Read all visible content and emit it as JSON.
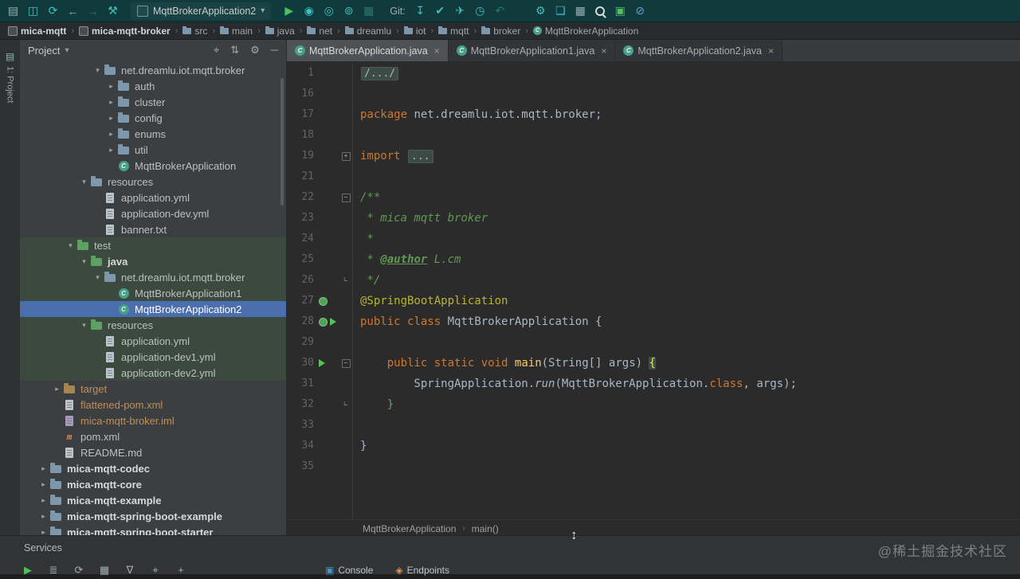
{
  "ui": {
    "chevron": "▾",
    "close": "×",
    "tree_open": "▾",
    "tree_closed": "▸",
    "class_letter": "C",
    "maven_letter": "m",
    "fold_plus": "+",
    "fold_minus": "−",
    "fold_end": "∟"
  },
  "toolbar": {
    "run_config": "MqttBrokerApplication2",
    "git_label": "Git:",
    "groups": {
      "left": [
        {
          "name": "window-menu-icon",
          "glyph": "▤",
          "color": "gray"
        },
        {
          "name": "save-all-icon",
          "glyph": "◫",
          "color": "teal"
        },
        {
          "name": "sync-icon",
          "glyph": "⟳",
          "color": "teal"
        },
        {
          "name": "back-icon",
          "glyph": "←",
          "color": "gray"
        },
        {
          "name": "forward-icon",
          "glyph": "→",
          "color": "dim"
        },
        {
          "name": "build-icon",
          "glyph": "⚒",
          "color": "teal"
        }
      ],
      "run": [
        {
          "name": "run-icon",
          "glyph": "▶",
          "color": "green"
        },
        {
          "name": "debug-icon",
          "glyph": "◉",
          "color": "teal"
        },
        {
          "name": "coverage-icon",
          "glyph": "◎",
          "color": "teal"
        },
        {
          "name": "profiler-icon",
          "glyph": "⊚",
          "color": "teal"
        },
        {
          "name": "run-dashboard-icon",
          "glyph": "▦",
          "color": "dim"
        }
      ],
      "git": [
        {
          "name": "git-update-icon",
          "glyph": "↧",
          "color": "teal"
        },
        {
          "name": "git-commit-icon",
          "glyph": "✔",
          "color": "teal"
        },
        {
          "name": "git-push-icon",
          "glyph": "✈",
          "color": "teal"
        },
        {
          "name": "history-icon",
          "glyph": "◷",
          "color": "teal"
        },
        {
          "name": "rollback-icon",
          "glyph": "↶",
          "color": "dim"
        }
      ],
      "right": [
        {
          "name": "tools-icon",
          "glyph": "⚙",
          "color": "teal"
        },
        {
          "name": "open-folder-icon",
          "glyph": "❏",
          "color": "teal"
        },
        {
          "name": "layout-icon",
          "glyph": "▦",
          "color": "gray"
        },
        {
          "name": "search-everywhere-icon",
          "glyph": "search",
          "color": "light"
        },
        {
          "name": "plugin-icon",
          "glyph": "▣",
          "color": "green"
        },
        {
          "name": "do-not-disturb-icon",
          "glyph": "⊘",
          "color": "blue"
        }
      ]
    }
  },
  "breadcrumbs": {
    "separator": "›",
    "items": [
      {
        "label": "mica-mqtt",
        "icon": "module",
        "bold": true
      },
      {
        "label": "mica-mqtt-broker",
        "icon": "module",
        "bold": true
      },
      {
        "label": "src",
        "icon": "folder"
      },
      {
        "label": "main",
        "icon": "folder"
      },
      {
        "label": "java",
        "icon": "folder"
      },
      {
        "label": "net",
        "icon": "folder"
      },
      {
        "label": "dreamlu",
        "icon": "folder"
      },
      {
        "label": "iot",
        "icon": "folder"
      },
      {
        "label": "mqtt",
        "icon": "folder"
      },
      {
        "label": "broker",
        "icon": "folder"
      },
      {
        "label": "MqttBrokerApplication",
        "icon": "class"
      }
    ]
  },
  "stripe": {
    "label": "1: Project",
    "icon": "▤"
  },
  "project": {
    "title": "Project",
    "header_icons": [
      {
        "name": "locate-icon",
        "glyph": "⌖"
      },
      {
        "name": "expand-collapse-icon",
        "glyph": "⇅"
      },
      {
        "name": "settings-icon",
        "glyph": "⚙"
      },
      {
        "name": "hide-panel-icon",
        "glyph": "─"
      }
    ],
    "tree": [
      {
        "l": "net.dreamlu.iot.mqtt.broker",
        "d": 5,
        "a": "o",
        "i": "pkg"
      },
      {
        "l": "auth",
        "d": 6,
        "a": "c",
        "i": "pkg"
      },
      {
        "l": "cluster",
        "d": 6,
        "a": "c",
        "i": "pkg"
      },
      {
        "l": "config",
        "d": 6,
        "a": "c",
        "i": "pkg"
      },
      {
        "l": "enums",
        "d": 6,
        "a": "c",
        "i": "pkg"
      },
      {
        "l": "util",
        "d": 6,
        "a": "c",
        "i": "pkg"
      },
      {
        "l": "MqttBrokerApplication",
        "d": 6,
        "a": null,
        "i": "class"
      },
      {
        "l": "resources",
        "d": 4,
        "a": "o",
        "i": "folder"
      },
      {
        "l": "application.yml",
        "d": 5,
        "a": null,
        "i": "yml"
      },
      {
        "l": "application-dev.yml",
        "d": 5,
        "a": null,
        "i": "yml"
      },
      {
        "l": "banner.txt",
        "d": 5,
        "a": null,
        "i": "txt"
      },
      {
        "l": "test",
        "d": 3,
        "a": "o",
        "i": "folder-test",
        "cls": "testbg"
      },
      {
        "l": "java",
        "d": 4,
        "a": "o",
        "i": "folder-test",
        "cls": "testbg b"
      },
      {
        "l": "net.dreamlu.iot.mqtt.broker",
        "d": 5,
        "a": "o",
        "i": "pkg",
        "cls": "testbg"
      },
      {
        "l": "MqttBrokerApplication1",
        "d": 6,
        "a": null,
        "i": "class",
        "cls": "testbg"
      },
      {
        "l": "MqttBrokerApplication2",
        "d": 6,
        "a": null,
        "i": "class",
        "cls": "sel"
      },
      {
        "l": "resources",
        "d": 4,
        "a": "o",
        "i": "folder-test",
        "cls": "testbg"
      },
      {
        "l": "application.yml",
        "d": 5,
        "a": null,
        "i": "yml",
        "cls": "testbg"
      },
      {
        "l": "application-dev1.yml",
        "d": 5,
        "a": null,
        "i": "yml",
        "cls": "testbg"
      },
      {
        "l": "application-dev2.yml",
        "d": 5,
        "a": null,
        "i": "yml",
        "cls": "testbg"
      },
      {
        "l": "target",
        "d": 2,
        "a": "c",
        "i": "folder-exc",
        "cls": "exc"
      },
      {
        "l": "flattened-pom.xml",
        "d": 2,
        "a": null,
        "i": "xml",
        "cls": "exc"
      },
      {
        "l": "mica-mqtt-broker.iml",
        "d": 2,
        "a": null,
        "i": "iml",
        "cls": "exc"
      },
      {
        "l": "pom.xml",
        "d": 2,
        "a": null,
        "i": "maven"
      },
      {
        "l": "README.md",
        "d": 2,
        "a": null,
        "i": "md"
      },
      {
        "l": "mica-mqtt-codec",
        "d": 1,
        "a": "c",
        "i": "folder",
        "cls": "b"
      },
      {
        "l": "mica-mqtt-core",
        "d": 1,
        "a": "c",
        "i": "folder",
        "cls": "b"
      },
      {
        "l": "mica-mqtt-example",
        "d": 1,
        "a": "c",
        "i": "folder",
        "cls": "b"
      },
      {
        "l": "mica-mqtt-spring-boot-example",
        "d": 1,
        "a": "c",
        "i": "folder",
        "cls": "b"
      },
      {
        "l": "mica-mqtt-spring-boot-starter",
        "d": 1,
        "a": "c",
        "i": "folder",
        "cls": "b"
      }
    ]
  },
  "tabs": [
    {
      "label": "MqttBrokerApplication.java",
      "active": true
    },
    {
      "label": "MqttBrokerApplication1.java",
      "active": false
    },
    {
      "label": "MqttBrokerApplication2.java",
      "active": false
    }
  ],
  "editor": {
    "lines": [
      {
        "n": "1",
        "t": [
          {
            "t": "/.../",
            "c": "fold"
          }
        ]
      },
      {
        "n": "16",
        "t": []
      },
      {
        "n": "17",
        "t": [
          {
            "t": "package",
            "c": "k"
          },
          {
            "t": " net.dreamlu.iot.mqtt.broker;",
            "c": "d"
          }
        ]
      },
      {
        "n": "18",
        "t": []
      },
      {
        "n": "19",
        "t": [
          {
            "t": "import",
            "c": "k"
          },
          {
            "t": " ",
            "c": "d"
          },
          {
            "t": "...",
            "c": "fold"
          }
        ],
        "f": "p"
      },
      {
        "n": "21",
        "t": []
      },
      {
        "n": "22",
        "t": [
          {
            "t": "/**",
            "c": "doc"
          }
        ],
        "f": "m"
      },
      {
        "n": "23",
        "t": [
          {
            "t": " * mica mqtt broker",
            "c": "doc"
          }
        ]
      },
      {
        "n": "24",
        "t": [
          {
            "t": " *",
            "c": "doc"
          }
        ]
      },
      {
        "n": "25",
        "t": [
          {
            "t": " * ",
            "c": "doc"
          },
          {
            "t": "@author",
            "c": "tag"
          },
          {
            "t": " L.cm",
            "c": "doc"
          }
        ]
      },
      {
        "n": "26",
        "t": [
          {
            "t": " */",
            "c": "doc"
          }
        ],
        "f": "e"
      },
      {
        "n": "27",
        "t": [
          {
            "t": "@SpringBootApplication",
            "c": "ann"
          }
        ],
        "g": [
          "spring"
        ]
      },
      {
        "n": "28",
        "t": [
          {
            "t": "public",
            "c": "k"
          },
          {
            "t": " ",
            "c": "d"
          },
          {
            "t": "class",
            "c": "k"
          },
          {
            "t": " MqttBrokerApplication {",
            "c": "d"
          }
        ],
        "g": [
          "spring",
          "run"
        ]
      },
      {
        "n": "29",
        "t": []
      },
      {
        "n": "30",
        "t": [
          {
            "t": "    ",
            "c": "d"
          },
          {
            "t": "public",
            "c": "k"
          },
          {
            "t": " ",
            "c": "d"
          },
          {
            "t": "static",
            "c": "k"
          },
          {
            "t": " ",
            "c": "d"
          },
          {
            "t": "void",
            "c": "k"
          },
          {
            "t": " ",
            "c": "d"
          },
          {
            "t": "main",
            "c": "mth"
          },
          {
            "t": "(String[] args) ",
            "c": "d"
          },
          {
            "t": "{",
            "c": "bm"
          }
        ],
        "g": [
          "run"
        ],
        "f": "m"
      },
      {
        "n": "31",
        "t": [
          {
            "t": "        SpringApplication.",
            "c": "d"
          },
          {
            "t": "run",
            "c": "it"
          },
          {
            "t": "(MqttBrokerApplication.",
            "c": "d"
          },
          {
            "t": "class",
            "c": "k"
          },
          {
            "t": ", args);",
            "c": "d"
          }
        ]
      },
      {
        "n": "32",
        "t": [
          {
            "t": "    ",
            "c": "d"
          },
          {
            "t": "}",
            "c": "grn"
          }
        ],
        "f": "e"
      },
      {
        "n": "33",
        "t": []
      },
      {
        "n": "34",
        "t": [
          {
            "t": "}",
            "c": "d"
          }
        ]
      },
      {
        "n": "35",
        "t": []
      }
    ],
    "breadcrumbs": {
      "separator": "›",
      "items": [
        "MqttBrokerApplication",
        "main()"
      ]
    }
  },
  "bottom": {
    "services_label": "Services",
    "toolbar_icons": [
      {
        "name": "run-icon",
        "glyph": "▶",
        "color": "green"
      },
      {
        "name": "sort-icon",
        "glyph": "≣",
        "color": "gray"
      },
      {
        "name": "refresh-icon",
        "glyph": "⟳",
        "color": "gray"
      },
      {
        "name": "grid-icon",
        "glyph": "▦",
        "color": "gray"
      },
      {
        "name": "filter-icon",
        "glyph": "∇",
        "color": "gray"
      },
      {
        "name": "locate-icon",
        "glyph": "⌖",
        "color": "gray"
      },
      {
        "name": "add-icon",
        "glyph": "+",
        "color": "gray"
      }
    ],
    "tabs": [
      {
        "label": "Console",
        "icon": "▣",
        "icon_color": "#3d96d0"
      },
      {
        "label": "Endpoints",
        "icon": "◈",
        "icon_color": "#e09552"
      }
    ]
  },
  "watermark": "@稀土掘金技术社区",
  "cursor_glyph": "↕"
}
